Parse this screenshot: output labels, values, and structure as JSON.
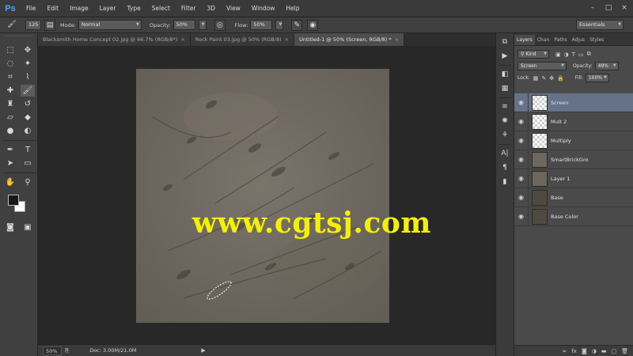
{
  "app": {
    "logo": "Ps",
    "menu": [
      "File",
      "Edit",
      "Image",
      "Layer",
      "Type",
      "Select",
      "Filter",
      "3D",
      "View",
      "Window",
      "Help"
    ],
    "window_controls": [
      "–",
      "□",
      "×"
    ]
  },
  "options": {
    "brush_size": "125",
    "mode_label": "Mode:",
    "mode_value": "Normal",
    "opacity_label": "Opacity:",
    "opacity_value": "50%",
    "flow_label": "Flow:",
    "flow_value": "50%",
    "workspace": "Essentials"
  },
  "tabs": [
    {
      "label": "Blacksmith Home Concept 02.jpg @ 66.7% (RGB/8*)",
      "active": false
    },
    {
      "label": "Rock Paint 03.jpg @ 50% (RGB/8)",
      "active": false
    },
    {
      "label": "Untitled-1 @ 50% (Screen, RGB/8) *",
      "active": true
    }
  ],
  "watermark": "www.cgtsj.com",
  "status": {
    "zoom": "50%",
    "doc": "Doc: 3.00M/21.0M"
  },
  "layers_panel": {
    "tabs": [
      "Layers",
      "Chan",
      "Paths",
      "Adjus",
      "Styles"
    ],
    "kind_value": "Kind",
    "blend_value": "Screen",
    "opacity_label": "Opacity:",
    "opacity_value": "49%",
    "lock_label": "Lock:",
    "fill_label": "Fill:",
    "fill_value": "100%",
    "layers": [
      {
        "name": "Screen",
        "thumb": "trans",
        "selected": true
      },
      {
        "name": "Mult 2",
        "thumb": "trans",
        "selected": false
      },
      {
        "name": "Multiply",
        "thumb": "trans",
        "selected": false
      },
      {
        "name": "SmartBrickGro",
        "thumb": "tex",
        "selected": false
      },
      {
        "name": "Layer 1",
        "thumb": "tex",
        "selected": false
      },
      {
        "name": "Base",
        "thumb": "dark",
        "selected": false
      },
      {
        "name": "Base Color",
        "thumb": "dark",
        "selected": false
      }
    ]
  }
}
